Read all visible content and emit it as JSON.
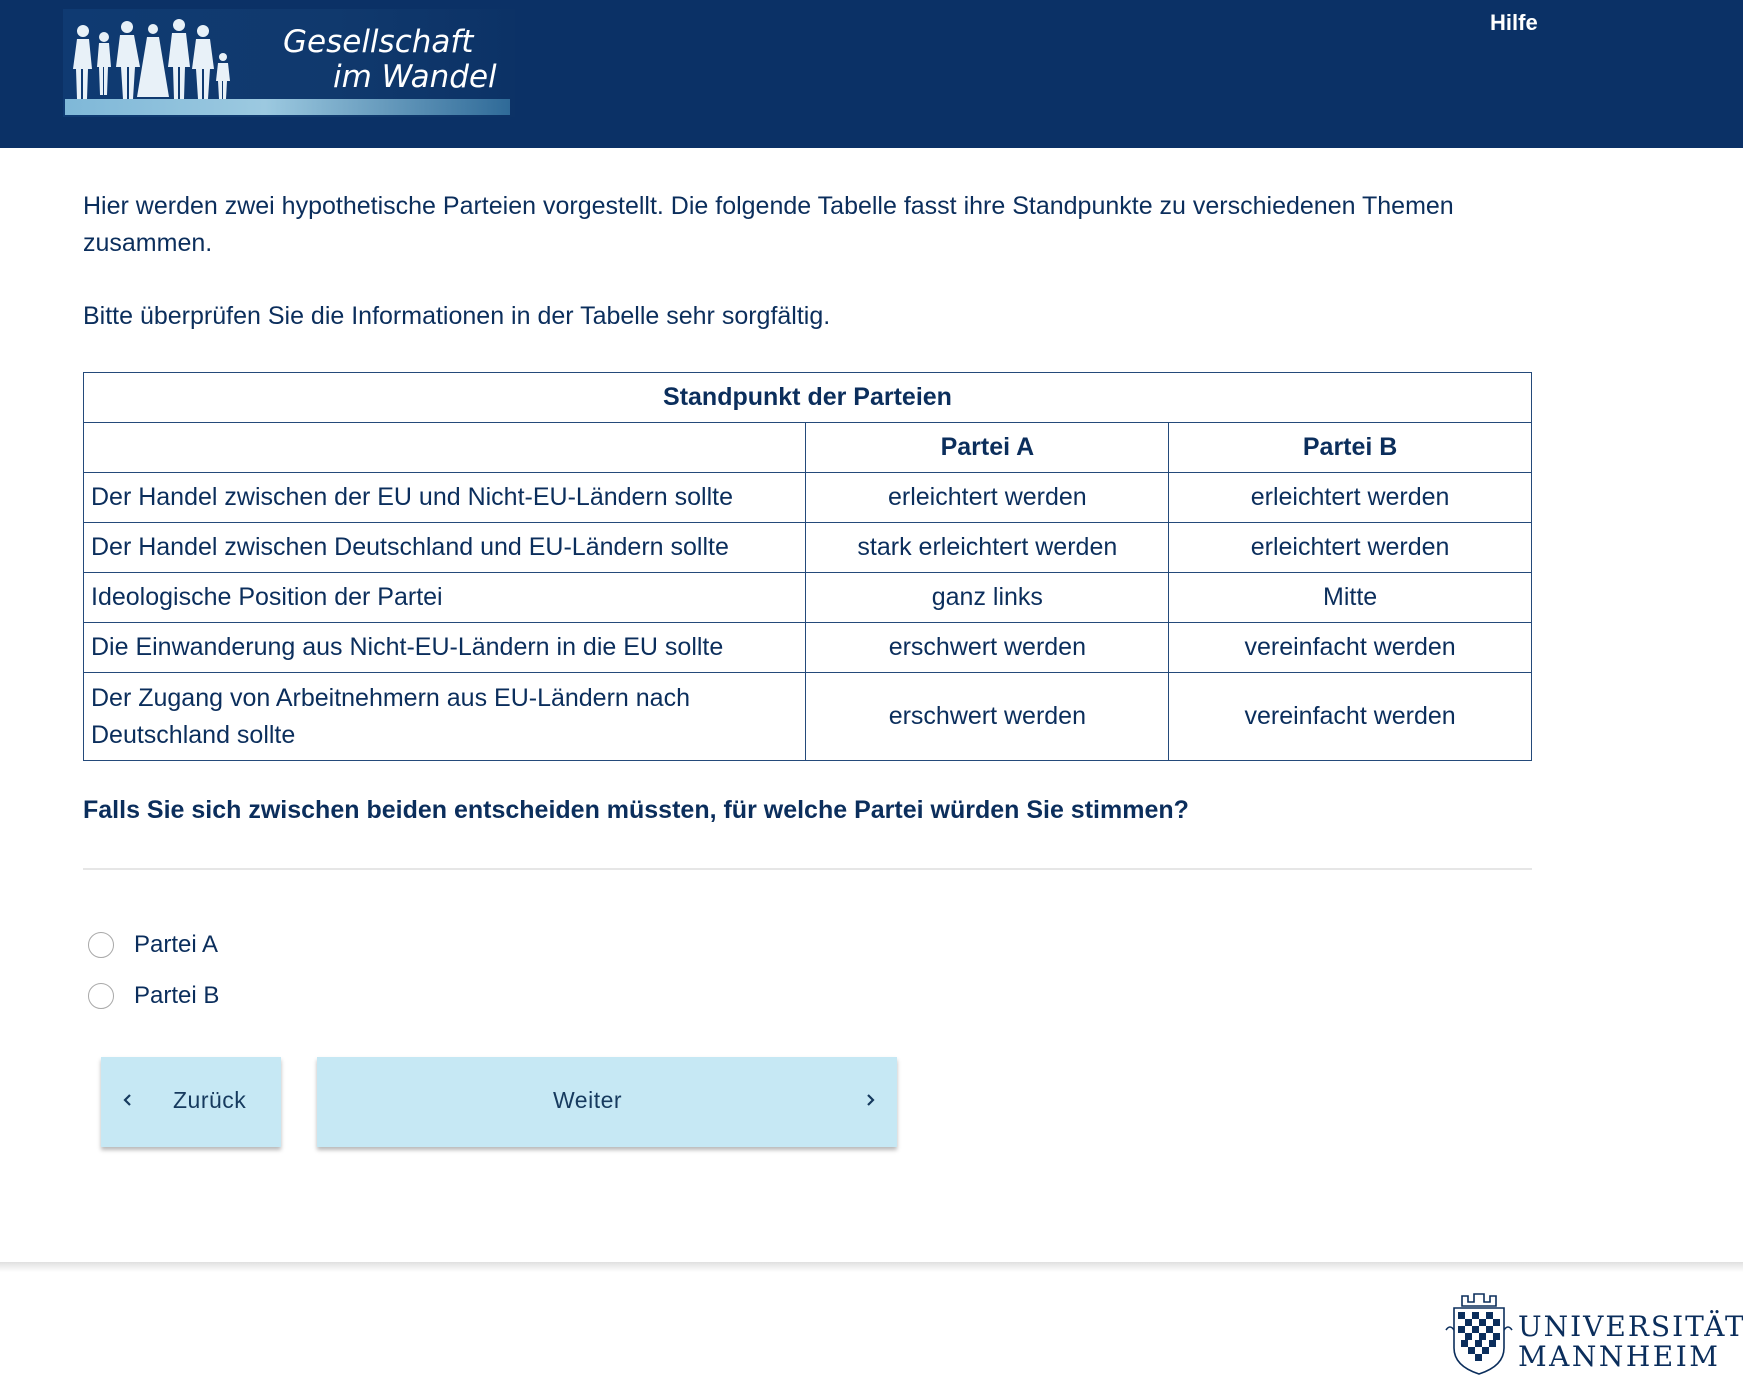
{
  "header": {
    "logo_line1": "Gesellschaft",
    "logo_line2": "im Wandel",
    "help_label": "Hilfe"
  },
  "intro": {
    "text": "Hier werden zwei hypothetische Parteien vorgestellt. Die folgende Tabelle fasst ihre Standpunkte zu verschiedenen Themen zusammen.",
    "note": "Bitte überprüfen Sie die Informationen in der Tabelle sehr sorgfältig."
  },
  "table": {
    "title": "Standpunkt der Parteien",
    "columns": [
      "",
      "Partei A",
      "Partei B"
    ],
    "rows": [
      [
        "Der Handel zwischen der EU und Nicht-EU-Ländern sollte",
        "erleichtert werden",
        "erleichtert werden"
      ],
      [
        "Der Handel zwischen Deutschland und EU-Ländern sollte",
        "stark erleichtert werden",
        "erleichtert werden"
      ],
      [
        "Ideologische Position der Partei",
        "ganz links",
        "Mitte"
      ],
      [
        "Die Einwanderung aus Nicht-EU-Ländern in die EU sollte",
        "erschwert werden",
        "vereinfacht werden"
      ],
      [
        "Der Zugang von Arbeitnehmern aus EU-Ländern nach Deutschland sollte",
        "erschwert werden",
        "vereinfacht werden"
      ]
    ]
  },
  "question": {
    "text": "Falls Sie sich zwischen beiden entscheiden müssten, für welche Partei würden Sie stimmen?",
    "options": [
      "Partei A",
      "Partei B"
    ],
    "selected": null
  },
  "buttons": {
    "back_label": "Zurück",
    "next_label": "Weiter"
  },
  "footer": {
    "university_line1": "UNIVERSITÄT",
    "university_line2": "MANNHEIM"
  },
  "colors": {
    "header_bg": "#0b3166",
    "text": "#0b2e5c",
    "button_bg": "#c6e8f4",
    "border": "#244a7a"
  },
  "icons": [
    "chevron-left-icon",
    "chevron-right-icon",
    "radio-icon",
    "university-crest-icon"
  ]
}
